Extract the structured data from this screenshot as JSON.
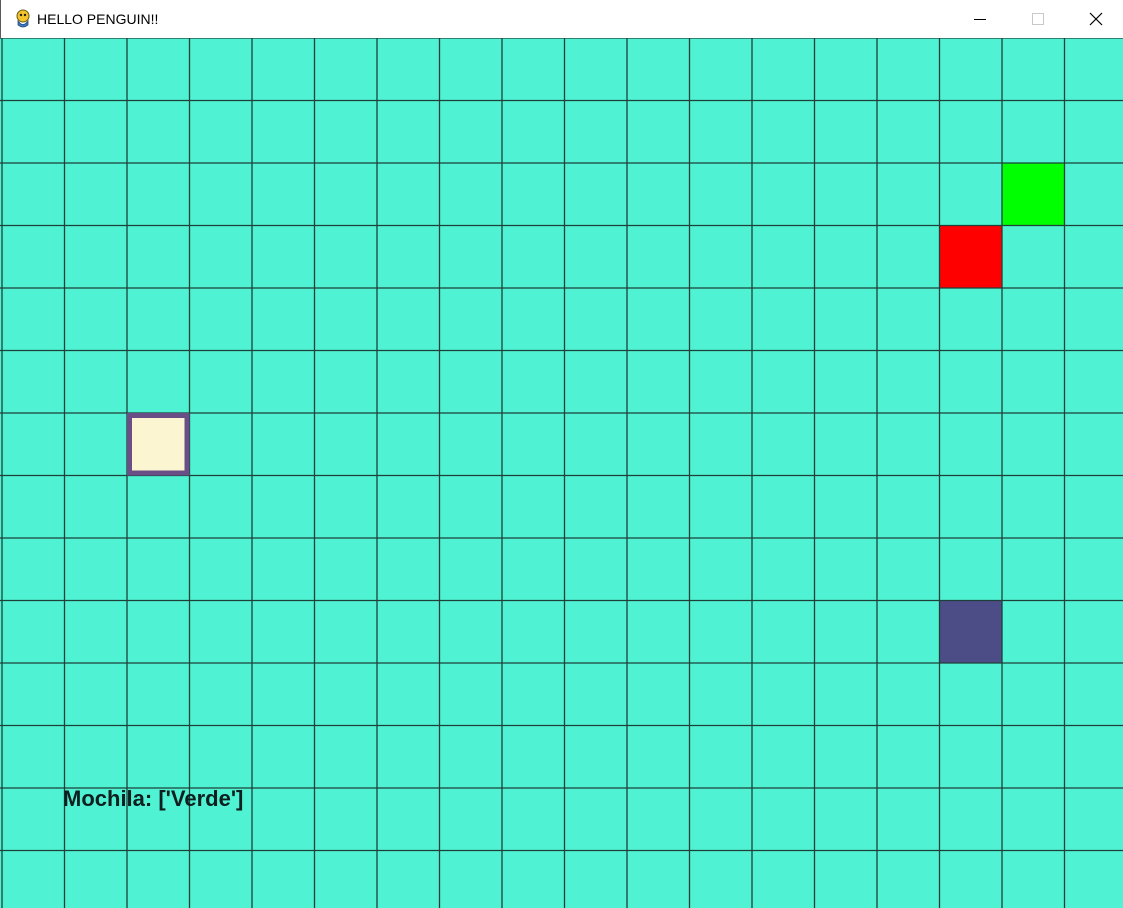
{
  "window": {
    "title": "HELLO PENGUIN!!",
    "app_icon": "pygame-snake-icon",
    "controls": [
      "minimize-icon",
      "maximize-icon",
      "close-icon"
    ]
  },
  "board": {
    "columns": 18,
    "rows": 14,
    "background_color": "#4ff2d2",
    "grid_line_color": "#1e3f3a",
    "tiles": [
      {
        "name": "green-tile",
        "col": 16,
        "row": 2,
        "fill": "#00ff00",
        "stroke": "#00ff00"
      },
      {
        "name": "red-tile",
        "col": 15,
        "row": 3,
        "fill": "#ff0000",
        "stroke": "#ff0000"
      },
      {
        "name": "player-tile",
        "col": 2,
        "row": 6,
        "fill": "#fbf5d1",
        "stroke": "#6a4f86"
      },
      {
        "name": "purple-tile",
        "col": 15,
        "row": 9,
        "fill": "#4c4c87",
        "stroke": "#4c4c87"
      }
    ]
  },
  "hud": {
    "backpack_text": "Mochila: ['Verde']"
  }
}
